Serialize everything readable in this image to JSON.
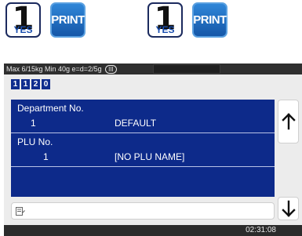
{
  "keys": [
    {
      "number": "1",
      "caption": "YES",
      "print_label": "PRINT"
    },
    {
      "number": "1",
      "caption": "YES",
      "print_label": "PRINT"
    }
  ],
  "status": {
    "scale_info": "Max 6/15kg Min 40g e=d=2/5g",
    "range_indicator": "III"
  },
  "code_digits": [
    "1",
    "1",
    "2",
    "0"
  ],
  "panel": {
    "department_label": "Department No.",
    "department_number": "1",
    "department_name": "DEFAULT",
    "plu_label": "PLU No.",
    "plu_number": "1",
    "plu_name": "[NO PLU NAME]"
  },
  "input": {
    "value": ""
  },
  "clock": "02:31:08",
  "icons": {
    "edit": "edit-icon",
    "up": "arrow-up-icon",
    "down": "arrow-down-icon"
  },
  "colors": {
    "panel_blue": "#0d2a8a",
    "print_blue": "#1e6fc4",
    "status_bar": "#2f2f2f",
    "screen_bg": "#ececec"
  }
}
